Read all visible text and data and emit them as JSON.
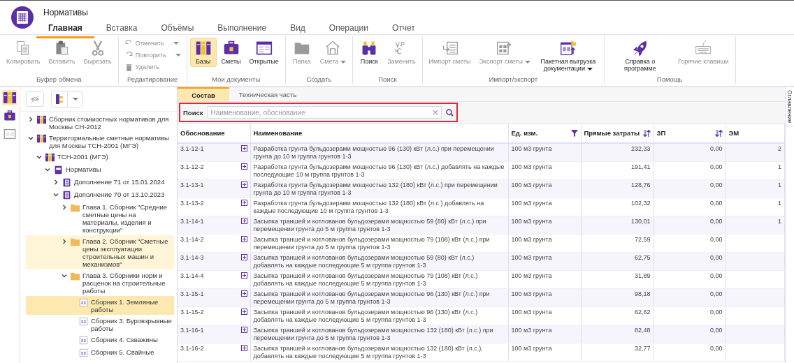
{
  "app": {
    "title": "Нормативы"
  },
  "menu_tabs": [
    {
      "label": "Главная",
      "selected": true
    },
    {
      "label": "Вставка",
      "selected": false
    },
    {
      "label": "Объёмы",
      "selected": false
    },
    {
      "label": "Выполнение",
      "selected": false
    },
    {
      "label": "Вид",
      "selected": false
    },
    {
      "label": "Операции",
      "selected": false
    },
    {
      "label": "Отчет",
      "selected": false
    }
  ],
  "ribbon": [
    {
      "label": "Буфер обмена",
      "kind": "large",
      "buttons": [
        {
          "label": "Копировать",
          "disabled": true,
          "selected": false,
          "dropdown": false
        },
        {
          "label": "Вставить",
          "disabled": true,
          "selected": false,
          "dropdown": false
        },
        {
          "label": "Вырезать",
          "disabled": true,
          "selected": false,
          "dropdown": false
        }
      ]
    },
    {
      "label": "Редактирование",
      "kind": "small",
      "buttons": [
        {
          "label": "Отменить",
          "disabled": true,
          "selected": false,
          "dropdown": true
        },
        {
          "label": "Повторить",
          "disabled": true,
          "selected": false,
          "dropdown": true
        },
        {
          "label": "Удалить",
          "disabled": true,
          "selected": false,
          "dropdown": false
        }
      ]
    },
    {
      "label": "Мои документы",
      "kind": "large",
      "buttons": [
        {
          "label": "Базы",
          "disabled": false,
          "selected": true,
          "dropdown": false
        },
        {
          "label": "Сметы",
          "disabled": false,
          "selected": false,
          "dropdown": false
        },
        {
          "label": "Открытые",
          "disabled": false,
          "selected": false,
          "dropdown": false
        }
      ]
    },
    {
      "label": "Создать",
      "kind": "large",
      "buttons": [
        {
          "label": "Папка",
          "disabled": true,
          "selected": false,
          "dropdown": false
        },
        {
          "label": "Смета",
          "disabled": true,
          "selected": false,
          "dropdown": true
        }
      ]
    },
    {
      "label": "Поиск",
      "kind": "large",
      "buttons": [
        {
          "label": "Поиск",
          "disabled": false,
          "selected": false,
          "dropdown": false
        },
        {
          "label": "Заменить",
          "disabled": true,
          "selected": false,
          "dropdown": false
        }
      ]
    },
    {
      "label": "Импорт/экспорт",
      "kind": "large",
      "buttons": [
        {
          "label": "Импорт сметы",
          "disabled": true,
          "selected": false,
          "dropdown": false
        },
        {
          "label": "Экспорт сметы",
          "disabled": true,
          "selected": false,
          "dropdown": true
        },
        {
          "label": "Пакетная выгрузка документации",
          "disabled": false,
          "selected": false,
          "dropdown": true
        }
      ]
    },
    {
      "label": "Помощь",
      "kind": "large",
      "buttons": [
        {
          "label": "Справка о программе",
          "disabled": false,
          "selected": false,
          "dropdown": false
        },
        {
          "label": "Горячие клавиши",
          "disabled": true,
          "selected": false,
          "dropdown": false
        }
      ]
    }
  ],
  "nav_buttons": [
    {
      "selected": true
    },
    {
      "selected": false
    },
    {
      "selected": false
    }
  ],
  "tree": [
    {
      "label": "Сборник стоимостных нормативов для Москвы СН-2012",
      "kind": "database",
      "expanded": false,
      "selected": false,
      "highlighted": false
    },
    {
      "label": "Территориальные сметные нормативы для Москвы ТСН-2001 (МГЭ)",
      "kind": "database",
      "expanded": true,
      "selected": false,
      "highlighted": false,
      "children": [
        {
          "label": "ТСН-2001 (МГЭ)",
          "kind": "database",
          "expanded": true,
          "selected": false,
          "highlighted": false,
          "children": [
            {
              "label": "Нормативы",
              "kind": "book",
              "expanded": true,
              "selected": false,
              "highlighted": false,
              "children": [
                {
                  "label": "Дополнение 71 от 15.01.2024",
                  "kind": "document",
                  "expanded": false,
                  "selected": false,
                  "highlighted": false
                },
                {
                  "label": "Дополнение 70 от 13.10.2023",
                  "kind": "document",
                  "expanded": true,
                  "selected": false,
                  "highlighted": false,
                  "children": [
                    {
                      "label": "Глава 1. Сборник \"Средние сметные цены на материалы, изделия и конструкции\"",
                      "kind": "folder",
                      "expanded": false,
                      "selected": false,
                      "highlighted": false
                    },
                    {
                      "label": "Глава 2. Сборник \"Сметные цены эксплуатации строительных машин и механизмов\"",
                      "kind": "folder",
                      "expanded": false,
                      "selected": false,
                      "highlighted": true
                    },
                    {
                      "label": "Глава  3. Сборники норм и расценок на строительные работы",
                      "kind": "folder",
                      "expanded": true,
                      "selected": false,
                      "highlighted": false,
                      "children": [
                        {
                          "label": "Сборник  1. Земляные работы",
                          "kind": "table",
                          "selected": true,
                          "highlighted": false
                        },
                        {
                          "label": "Сборник  3. Буровзрывные работы",
                          "kind": "table",
                          "selected": false,
                          "highlighted": false
                        },
                        {
                          "label": "Сборник  4. Скважины",
                          "kind": "table",
                          "selected": false,
                          "highlighted": false
                        },
                        {
                          "label": "Сборник  5. Свайные",
                          "kind": "table",
                          "selected": false,
                          "highlighted": false
                        }
                      ]
                    }
                  ]
                }
              ]
            }
          ]
        }
      ]
    }
  ],
  "content_tabs": [
    {
      "label": "Состав",
      "selected": true
    },
    {
      "label": "Техническая часть",
      "selected": false
    }
  ],
  "search": {
    "label": "Поиск",
    "placeholder": "Наименование, обоснование"
  },
  "table": {
    "columns": [
      {
        "label": "Обоснование",
        "filtered": false,
        "sortable": false
      },
      {
        "label": "Наименование",
        "filtered": false,
        "sortable": false
      },
      {
        "label": "Ед. изм.",
        "filtered": true,
        "sortable": false
      },
      {
        "label": "Прямые затраты",
        "filtered": false,
        "sortable": true
      },
      {
        "label": "ЗП",
        "filtered": false,
        "sortable": true
      },
      {
        "label": "ЭМ",
        "filtered": false,
        "sortable": false
      }
    ],
    "rows": [
      {
        "code": "3.1-12-1",
        "name": "Разработка грунта бульдозерами мощностью 96 (130) кВт (л.с.) при перемещении грунта до 10 м группа грунтов 1-3",
        "unit": "100 м3 грунта",
        "direct": "232,33",
        "zp": "0,00",
        "em": "2"
      },
      {
        "code": "3.1-12-2",
        "name": "Разработка грунта бульдозерами мощностью 96 (130) кВт (л.с.) добавлять на каждые последующие 10 м группа грунтов 1-3",
        "unit": "100 м3 грунта",
        "direct": "191,41",
        "zp": "0,00",
        "em": "1"
      },
      {
        "code": "3.1-13-1",
        "name": "Разработка грунта бульдозерами мощностью 132 (180) кВт (л.с.) при перемещении грунта до 10 м группа грунтов 1-3",
        "unit": "100 м3 грунта",
        "direct": "128,76",
        "zp": "0,00",
        "em": "1"
      },
      {
        "code": "3.1-13-2",
        "name": "Разработка грунта бульдозерами мощностью 132 (180) кВт (л.с.) добавлять на каждые последующие 10 м группа грунтов 1-3",
        "unit": "100 м3 грунта",
        "direct": "102,32",
        "zp": "0,00",
        "em": "1"
      },
      {
        "code": "3.1-14-1",
        "name": "Засыпка траншей и котлованов бульдозерами мощностью 59 (80) кВт (л.с.) при перемещении грунта до 5 м группа грунтов 1-3",
        "unit": "100 м3 грунта",
        "direct": "130,01",
        "zp": "0,00",
        "em": "1"
      },
      {
        "code": "3.1-14-2",
        "name": "Засыпка траншей и котлованов бульдозерами мощностью 79 (108) кВт (л.с.) при перемещении грунта до 5 м группа грунтов 1-3",
        "unit": "100 м3 грунта",
        "direct": "72,59",
        "zp": "0,00"
      },
      {
        "code": "3.1-14-3",
        "name": "Засыпка траншей и котлованов бульдозерами мощностью 59 (80) кВт (л.с.) добавлять на каждые последующие 5 м группа грунтов 1-3",
        "unit": "100 м3 грунта",
        "direct": "62,75",
        "zp": "0,00"
      },
      {
        "code": "3.1-14-4",
        "name": "Засыпка траншей и котлованов бульдозерами мощностью 79 (108) кВт (л.с.) добавлять на каждые последующие 5 м группа грунтов 1-3",
        "unit": "100 м3 грунта",
        "direct": "31,89",
        "zp": "0,00"
      },
      {
        "code": "3.1-15-1",
        "name": "Засыпка траншей и котлованов бульдозерами мощностью 96 (130) кВт (л.с.) при перемещении грунта до 5 м группа грунтов 1-3",
        "unit": "100 м3 грунта",
        "direct": "98,18",
        "zp": "0,00"
      },
      {
        "code": "3.1-15-2",
        "name": "Засыпка траншей и котлованов бульдозерами мощностью 96 (130) кВт (л.с.) добавлять на каждые последующие 5 м группа грунтов 1-3",
        "unit": "100 м3 грунта",
        "direct": "62,62",
        "zp": "0,00"
      },
      {
        "code": "3.1-16-1",
        "name": "Засыпка траншей и котлованов бульдозерами мощностью 132 (180) кВт (л.с.) при перемещении грунта до 5 м группа грунтов 1-3",
        "unit": "100 м3 грунта",
        "direct": "82,48",
        "zp": "0,00"
      },
      {
        "code": "3.1-16-2",
        "name": "Засыпка траншей и котлованов бульдозерами мощностью 132 (180) кВт (л.с.), добавлять на каждые последующие 5 м группа грунтов 1-3",
        "unit": "100 м3 грунта",
        "direct": "32,77",
        "zp": "0,00"
      }
    ]
  },
  "side_tab": {
    "label": "Оглавление"
  }
}
